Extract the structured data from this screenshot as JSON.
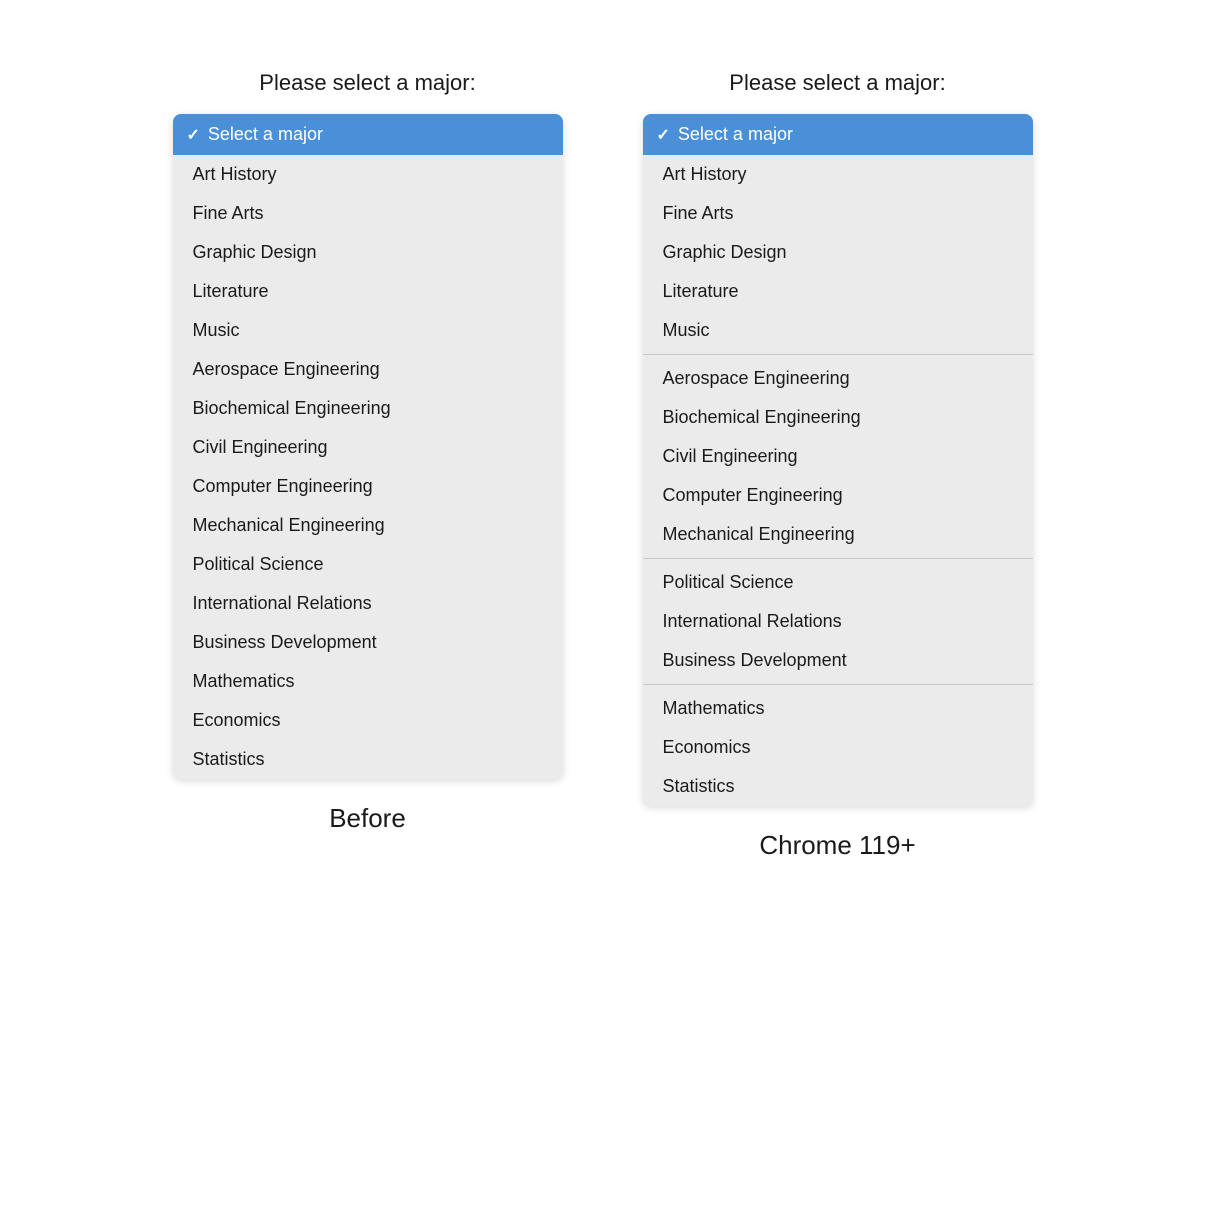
{
  "before": {
    "label": "Please select a major:",
    "footer": "Before",
    "selected": {
      "checkmark": "✓",
      "text": "Select a major"
    },
    "items": [
      "Art History",
      "Fine Arts",
      "Graphic Design",
      "Literature",
      "Music",
      "Aerospace Engineering",
      "Biochemical Engineering",
      "Civil Engineering",
      "Computer Engineering",
      "Mechanical Engineering",
      "Political Science",
      "International Relations",
      "Business Development",
      "Mathematics",
      "Economics",
      "Statistics"
    ]
  },
  "after": {
    "label": "Please select a major:",
    "footer": "Chrome 119+",
    "selected": {
      "checkmark": "✓",
      "text": "Select a major"
    },
    "groups": [
      [
        "Art History",
        "Fine Arts",
        "Graphic Design",
        "Literature",
        "Music"
      ],
      [
        "Aerospace Engineering",
        "Biochemical Engineering",
        "Civil Engineering",
        "Computer Engineering",
        "Mechanical Engineering"
      ],
      [
        "Political Science",
        "International Relations",
        "Business Development"
      ],
      [
        "Mathematics",
        "Economics",
        "Statistics"
      ]
    ]
  }
}
